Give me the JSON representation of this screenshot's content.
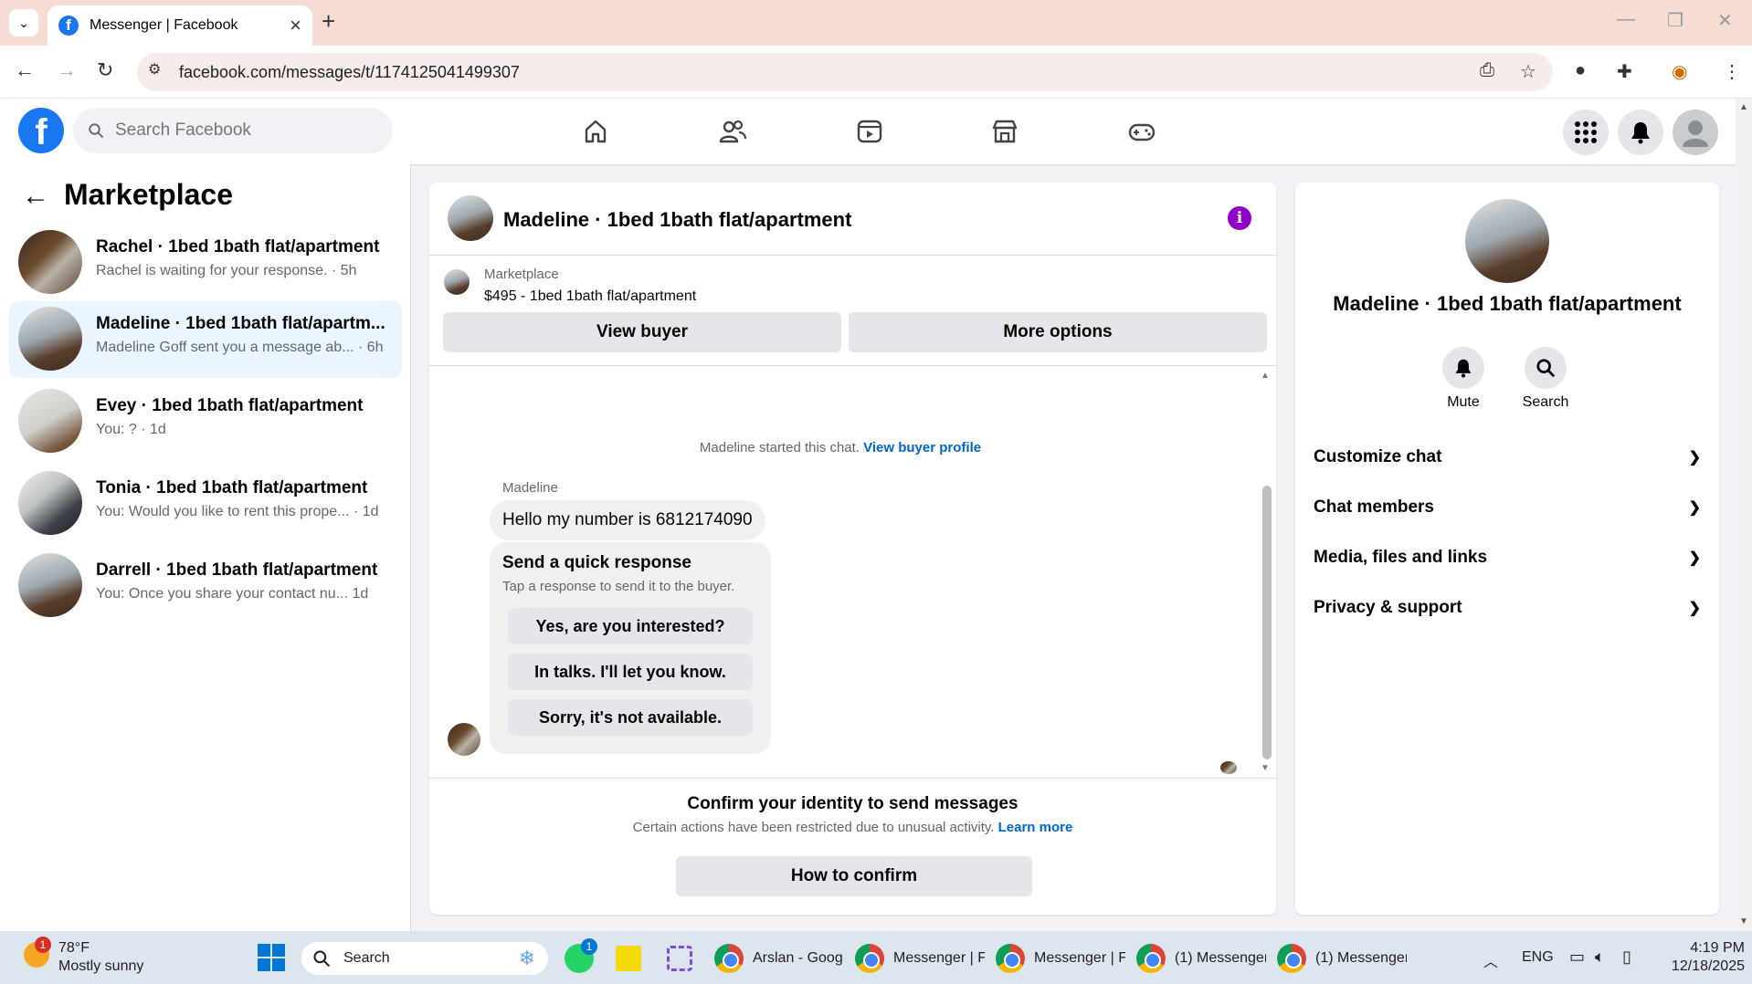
{
  "browser": {
    "tab_title": "Messenger | Facebook",
    "url": "facebook.com/messages/t/1174125041499307"
  },
  "header": {
    "search_placeholder": "Search Facebook"
  },
  "left": {
    "title": "Marketplace",
    "conversations": [
      {
        "name": "Rachel · 1bed 1bath flat/apartment",
        "snippet": "Rachel is waiting for your response. · 5h"
      },
      {
        "name": "Madeline · 1bed 1bath flat/apartm...",
        "snippet": "Madeline Goff sent you a message ab... · 6h"
      },
      {
        "name": "Evey · 1bed 1bath flat/apartment",
        "snippet": "You: ? · 1d"
      },
      {
        "name": "Tonia · 1bed 1bath flat/apartment",
        "snippet": "You: Would you like to rent this prope... · 1d"
      },
      {
        "name": "Darrell · 1bed 1bath flat/apartment",
        "snippet": "You: Once you share your contact nu...    1d"
      }
    ]
  },
  "chat": {
    "title": "Madeline · 1bed 1bath flat/apartment",
    "marketplace_label": "Marketplace",
    "listing": "$495 - 1bed 1bath flat/apartment",
    "view_buyer": "View buyer",
    "more_options": "More options",
    "started_text": "Madeline started this chat.",
    "view_buyer_profile": "View buyer profile",
    "sender": "Madeline",
    "message": "Hello my number is 6812174090",
    "quick_title": "Send a quick response",
    "quick_sub": "Tap a response to send it to the buyer.",
    "quick_responses": [
      "Yes, are you interested?",
      "In talks. I'll let you know.",
      "Sorry, it's not available."
    ],
    "confirm_title": "Confirm your identity to send messages",
    "confirm_sub": "Certain actions have been restricted due to unusual activity.",
    "learn_more": "Learn more",
    "how_to_confirm": "How to confirm"
  },
  "right": {
    "name": "Madeline · 1bed 1bath flat/apartment",
    "mute": "Mute",
    "search": "Search",
    "sections": [
      "Customize chat",
      "Chat members",
      "Media, files and links",
      "Privacy & support"
    ]
  },
  "taskbar": {
    "weather_temp": "78°F",
    "weather_desc": "Mostly sunny",
    "weather_badge": "1",
    "search": "Search",
    "whatsapp_badge": "1",
    "apps": [
      "Arslan - Goog",
      "Messenger | F",
      "Messenger | F",
      "(1) Messenger",
      "(1) Messenger"
    ],
    "lang": "ENG",
    "time": "4:19 PM",
    "date": "12/18/2025"
  },
  "colors": {
    "facebook_blue": "#1877f2",
    "link_blue": "#0064d1",
    "info_purple": "#9000c9",
    "active_conv": "#ebf5ff"
  }
}
